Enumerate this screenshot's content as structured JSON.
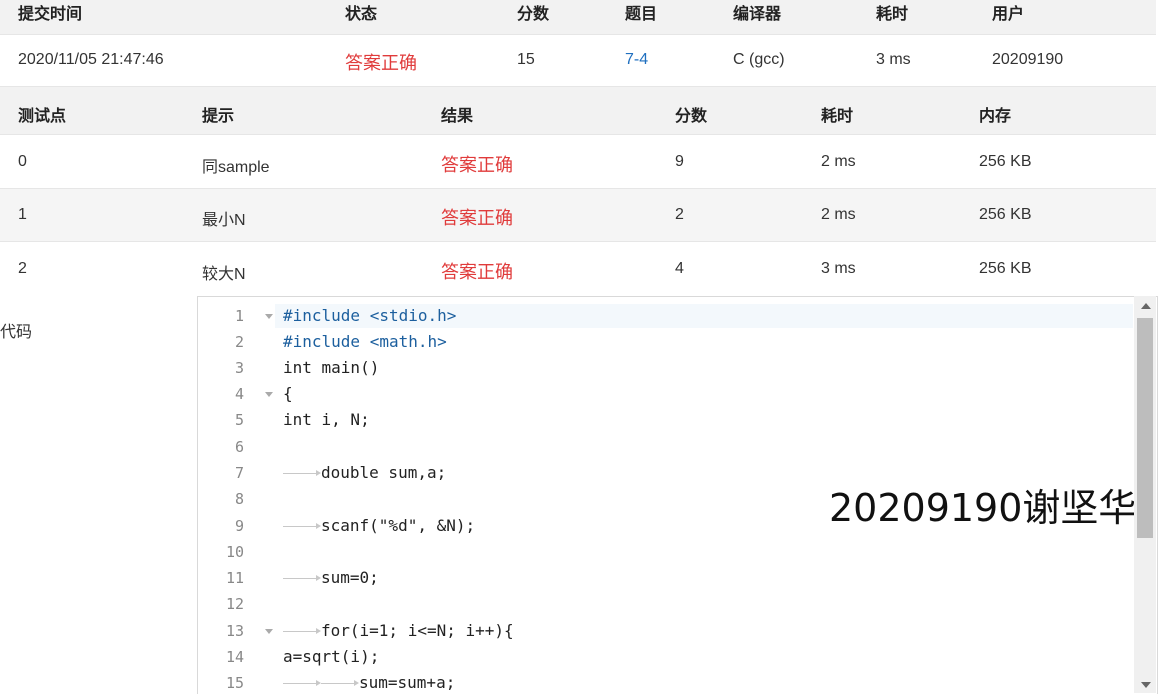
{
  "submission": {
    "headers": [
      "提交时间",
      "状态",
      "分数",
      "题目",
      "编译器",
      "耗时",
      "用户"
    ],
    "row": {
      "time": "2020/11/05 21:47:46",
      "status": "答案正确",
      "score": "15",
      "problem": "7-4",
      "compiler": "C (gcc)",
      "elapsed": "3 ms",
      "user": "20209190"
    }
  },
  "tests": {
    "headers": [
      "测试点",
      "提示",
      "结果",
      "分数",
      "耗时",
      "内存"
    ],
    "rows": [
      {
        "id": "0",
        "hint": "同sample",
        "result": "答案正确",
        "score": "9",
        "time": "2 ms",
        "memory": "256 KB"
      },
      {
        "id": "1",
        "hint": "最小N",
        "result": "答案正确",
        "score": "2",
        "time": "2 ms",
        "memory": "256 KB"
      },
      {
        "id": "2",
        "hint": "较大N",
        "result": "答案正确",
        "score": "4",
        "time": "3 ms",
        "memory": "256 KB"
      }
    ]
  },
  "code": {
    "label": "代码",
    "line_numbers": [
      "1",
      "2",
      "3",
      "4",
      "5",
      "6",
      "7",
      "8",
      "9",
      "10",
      "11",
      "12",
      "13",
      "14",
      "15"
    ],
    "lines": [
      "#include <stdio.h>",
      "#include <math.h>",
      "int main()",
      "{",
      "int i, N;",
      "",
      "double sum,a;",
      "",
      "scanf(\"%d\", &N);",
      "",
      "sum=0;",
      "",
      "for(i=1; i<=N; i++){",
      "a=sqrt(i);",
      "sum=sum+a;"
    ]
  },
  "watermark": "20209190谢坚华",
  "colors": {
    "accent_red": "#e03b3b",
    "link_blue": "#1f6fbf"
  }
}
